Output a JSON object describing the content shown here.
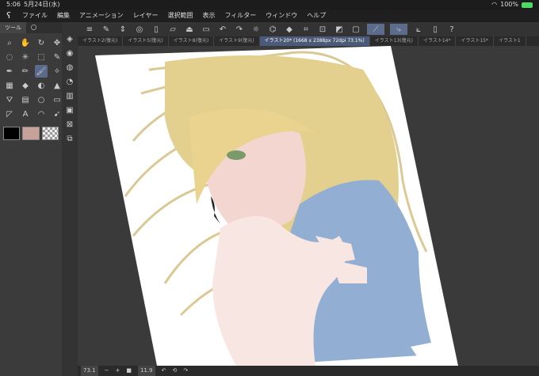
{
  "status": {
    "time": "5:06",
    "date": "5月24日(水)",
    "battery": "100%"
  },
  "menu": [
    "ファイル",
    "編集",
    "アニメーション",
    "レイヤー",
    "選択範囲",
    "表示",
    "フィルター",
    "ウィンドウ",
    "ヘルプ"
  ],
  "toolbox": {
    "tab1": "ツール",
    "tab2": "〇"
  },
  "tabs": [
    "イラスト2(復元)",
    "イラスト5(復元)",
    "イラスト8(復元)",
    "イラスト9(復元)",
    "イラスト20* (1668 x 2388px 72dpi 73.1%)",
    "イラスト13(復元)",
    "イラスト14*",
    "イラスト15*",
    "イラスト1"
  ],
  "bottom": {
    "zoom": "73.1",
    "angle": "11.9"
  }
}
